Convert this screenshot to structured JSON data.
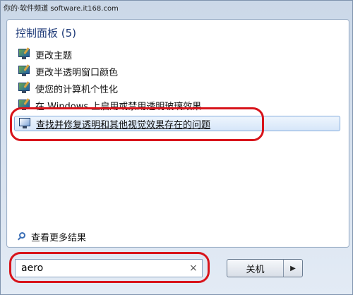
{
  "watermark": "你的·软件频道 software.it168.com",
  "panel": {
    "section_title": "控制面板 (5)",
    "items": [
      {
        "label": "更改主题"
      },
      {
        "label": "更改半透明窗口颜色"
      },
      {
        "label": "使您的计算机个性化"
      },
      {
        "label": "在 Windows 上启用或禁用透明玻璃效果"
      },
      {
        "label": "查找并修复透明和其他视觉效果存在的问题"
      }
    ],
    "more_results": "查看更多结果"
  },
  "search": {
    "value": "aero",
    "clear_icon": "×"
  },
  "shutdown": {
    "label": "关机",
    "arrow": "▶"
  },
  "annotation_color": "#d8141b"
}
